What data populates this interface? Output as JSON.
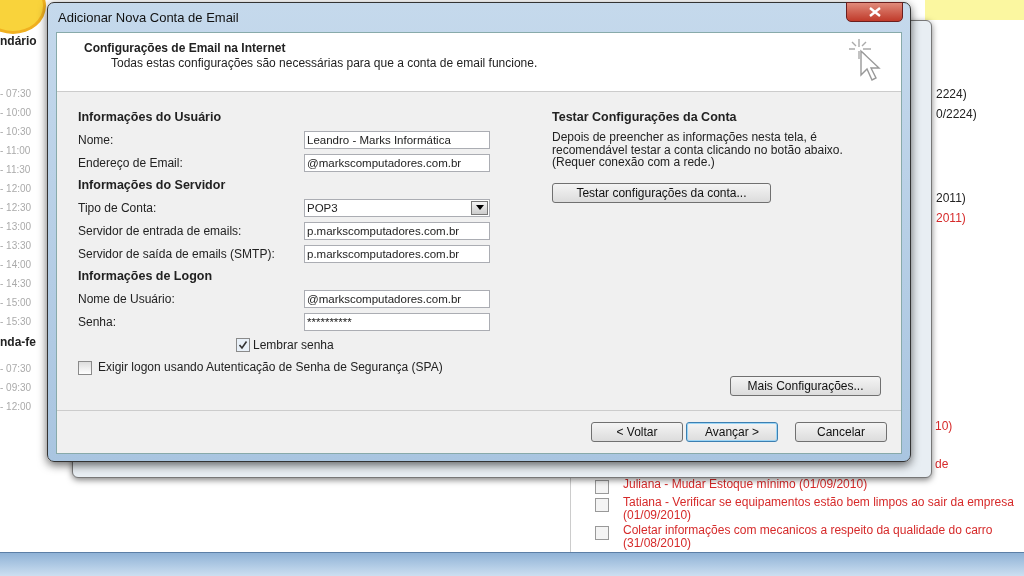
{
  "background": {
    "calendar_heading": "ndário",
    "times": [
      "- 07:30",
      "- 10:00",
      "- 10:30",
      "- 11:00",
      "- 11:30",
      "- 12:00",
      "- 12:30",
      "- 13:00",
      "- 13:30",
      "- 14:00",
      "- 14:30",
      "- 15:00",
      "- 15:30"
    ],
    "day_heading": "nda-fe",
    "day_times": [
      "- 07:30",
      "- 09:30",
      "- 12:00"
    ],
    "fragments": [
      {
        "text": "2224)",
        "overdue": false
      },
      {
        "text": "0/2224)",
        "overdue": false
      },
      {
        "text": "2011)",
        "overdue": false
      },
      {
        "text": "2011)",
        "overdue": true
      }
    ],
    "lower_fragments": [
      {
        "text": "10)",
        "overdue": true
      },
      {
        "text": "de",
        "overdue": true
      }
    ],
    "tasks": [
      {
        "text": "Juliana - Mudar Estoque mínimo (01/09/2010)",
        "checked": false
      },
      {
        "text": "Tatiana - Verificar se equipamentos estão bem limpos ao sair da empresa (01/09/2010)",
        "checked": false
      },
      {
        "text": "Coletar informações com mecanicos a respeito da qualidade do carro (31/08/2010)",
        "checked": false
      }
    ]
  },
  "window": {
    "title": "Adicionar Nova Conta de Email"
  },
  "header": {
    "title": "Configurações de Email na Internet",
    "subtitle": "Todas estas configurações são necessárias para que a conta de email funcione."
  },
  "sections": [
    {
      "title": "Informações do Usuário",
      "fields": [
        {
          "label": "Nome:",
          "value": "Leandro - Marks Informática",
          "kind": "text"
        },
        {
          "label": "Endereço de Email:",
          "value": "@markscomputadores.com.br",
          "kind": "text"
        }
      ]
    },
    {
      "title": "Informações do Servidor",
      "fields": [
        {
          "label": "Tipo de Conta:",
          "value": "POP3",
          "kind": "select"
        },
        {
          "label": "Servidor de entrada de emails:",
          "value": "p.markscomputadores.com.br",
          "kind": "text"
        },
        {
          "label": "Servidor de saída de emails (SMTP):",
          "value": "p.markscomputadores.com.br",
          "kind": "text"
        }
      ]
    },
    {
      "title": "Informações de Logon",
      "fields": [
        {
          "label": "Nome de Usuário:",
          "value": "@markscomputadores.com.br",
          "kind": "text"
        },
        {
          "label": "Senha:",
          "value": "**********",
          "kind": "text"
        }
      ]
    }
  ],
  "remember_password": {
    "label": "Lembrar senha",
    "checked": true
  },
  "spa": {
    "label": "Exigir logon usando Autenticação de Senha de Segurança (SPA)",
    "checked": false
  },
  "test_panel": {
    "title": "Testar Configurações da Conta",
    "text": "Depois de preencher as informações nesta tela, é recomendável testar a conta clicando no botão abaixo. (Requer conexão com a rede.)",
    "button": "Testar configurações da conta..."
  },
  "more_settings": "Mais Configurações...",
  "buttons": [
    {
      "label": "< Voltar",
      "default": false
    },
    {
      "label": "Avançar >",
      "default": true
    },
    {
      "label": "Cancelar",
      "default": false
    }
  ]
}
